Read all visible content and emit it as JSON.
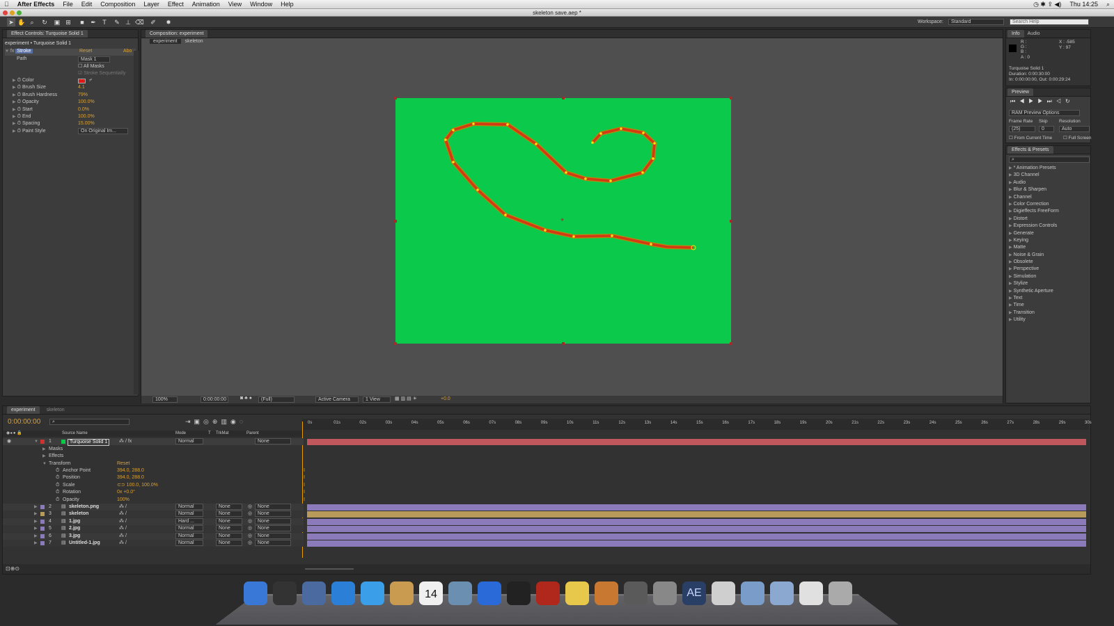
{
  "menubar": {
    "app": "After Effects",
    "items": [
      "File",
      "Edit",
      "Composition",
      "Layer",
      "Effect",
      "Animation",
      "View",
      "Window",
      "Help"
    ],
    "clock": "Thu 14:25"
  },
  "window": {
    "title": "skeleton save.aep *"
  },
  "toolbar": {
    "workspace_label": "Workspace:",
    "workspace_value": "Standard",
    "search_placeholder": "Search Help"
  },
  "effect_controls": {
    "tab": "Effect Controls: Turquoise Solid 1",
    "breadcrumb": "experiment • Turquoise Solid 1",
    "effect_name": "Stroke",
    "reset": "Reset",
    "about": "Abo",
    "path_label": "Path",
    "path_value": "Mask 1",
    "all_masks": "All Masks",
    "stroke_seq": "Stroke Sequentially",
    "props": [
      {
        "name": "Color",
        "value": ""
      },
      {
        "name": "Brush Size",
        "value": "4.1"
      },
      {
        "name": "Brush Hardness",
        "value": "79%"
      },
      {
        "name": "Opacity",
        "value": "100.0%"
      },
      {
        "name": "Start",
        "value": "0.0%"
      },
      {
        "name": "End",
        "value": "100.0%"
      },
      {
        "name": "Spacing",
        "value": "15.00%"
      },
      {
        "name": "Paint Style",
        "value": "On Original Im..."
      }
    ],
    "color_swatch": "#e01818"
  },
  "composition": {
    "tab": "Composition: experiment",
    "crumbs": [
      "experiment",
      "skeleton"
    ],
    "zoom": "100%",
    "timecode": "0:00:00:00",
    "res": "(Full)",
    "camera": "Active Camera",
    "views": "1 View",
    "exposure": "+0.0",
    "bg_color": "#0bc94a",
    "stroke_color": "#d03a14"
  },
  "info": {
    "tabs": [
      "Info",
      "Audio"
    ],
    "r": "R :",
    "g": "G :",
    "b": "B :",
    "a": "A : 0",
    "x": "X : -585",
    "y": "Y : 97",
    "name": "Turquoise Solid 1",
    "duration": "Duration: 0:00:30:00",
    "inout": "In: 0:00:00:00, Out: 0:00:29:24"
  },
  "preview": {
    "tab": "Preview",
    "ram": "RAM Preview Options",
    "frame_rate_label": "Frame Rate",
    "skip_label": "Skip",
    "resolution_label": "Resolution",
    "frame_rate": "(25)",
    "skip": "0",
    "resolution": "Auto",
    "from_current": "From Current Time",
    "full_screen": "Full Screen"
  },
  "effects_presets": {
    "tab": "Effects & Presets",
    "items": [
      "* Animation Presets",
      "3D Channel",
      "Audio",
      "Blur & Sharpen",
      "Channel",
      "Color Correction",
      "Digieffects FreeForm",
      "Distort",
      "Expression Controls",
      "Generate",
      "Keying",
      "Matte",
      "Noise & Grain",
      "Obsolete",
      "Perspective",
      "Simulation",
      "Stylize",
      "Synthetic Aperture",
      "Text",
      "Time",
      "Transition",
      "Utility"
    ]
  },
  "timeline": {
    "tabs": [
      "experiment",
      "skeleton"
    ],
    "timecode": "0:00:00:00",
    "col_source": "Source Name",
    "col_mode": "Mode",
    "col_t": "T",
    "col_trkmat": "TrkMat",
    "col_parent": "Parent",
    "ruler": [
      "0s",
      "01s",
      "02s",
      "03s",
      "04s",
      "05s",
      "06s",
      "07s",
      "08s",
      "09s",
      "10s",
      "11s",
      "12s",
      "13s",
      "14s",
      "15s",
      "16s",
      "17s",
      "18s",
      "19s",
      "20s",
      "21s",
      "22s",
      "23s",
      "24s",
      "25s",
      "26s",
      "27s",
      "28s",
      "29s",
      "30s"
    ],
    "layer1": {
      "num": "1",
      "name": "Turquoise Solid 1",
      "mode": "Normal",
      "parent": "None"
    },
    "sub": {
      "masks": "Masks",
      "effects": "Effects",
      "transform": "Transform",
      "reset": "Reset"
    },
    "transform": [
      {
        "name": "Anchor Point",
        "value": "394.0, 288.0"
      },
      {
        "name": "Position",
        "value": "394.0, 288.0"
      },
      {
        "name": "Scale",
        "value": "⊂⊃ 100.0, 100.0%"
      },
      {
        "name": "Rotation",
        "value": "0x +0.0°"
      },
      {
        "name": "Opacity",
        "value": "100%"
      }
    ],
    "layers": [
      {
        "num": "2",
        "name": "skeleton.png",
        "mode": "Normal",
        "trk": "None",
        "parent": "None",
        "color": "#8c7bbb"
      },
      {
        "num": "3",
        "name": "skeleton",
        "mode": "Normal",
        "trk": "None",
        "parent": "None",
        "color": "#b89a5a"
      },
      {
        "num": "4",
        "name": "1.jpg",
        "mode": "Hard ...",
        "trk": "None",
        "parent": "None",
        "color": "#8c7bbb"
      },
      {
        "num": "5",
        "name": "2.jpg",
        "mode": "Normal",
        "trk": "None",
        "parent": "None",
        "color": "#8c7bbb"
      },
      {
        "num": "6",
        "name": "3.jpg",
        "mode": "Normal",
        "trk": "None",
        "parent": "None",
        "color": "#8c7bbb"
      },
      {
        "num": "7",
        "name": "Untitled-1.jpg",
        "mode": "Normal",
        "trk": "None",
        "parent": "None",
        "color": "#8c7bbb"
      }
    ]
  },
  "dock": {
    "icons": [
      "finder-icon",
      "dashboard-icon",
      "preview-icon",
      "safari-icon",
      "ichat-icon",
      "addressbook-icon",
      "ical-icon",
      "iphoto-icon",
      "itunes-icon",
      "imovie-icon",
      "photobooth-icon",
      "istar-icon",
      "garageband-icon",
      "timemachine-icon",
      "system-prefs-icon",
      "after-effects-icon",
      "utility-icon",
      "applications-folder-icon",
      "documents-folder-icon",
      "downloads-icon",
      "trash-icon"
    ],
    "ical_day": "14",
    "ae_label": "AE"
  }
}
